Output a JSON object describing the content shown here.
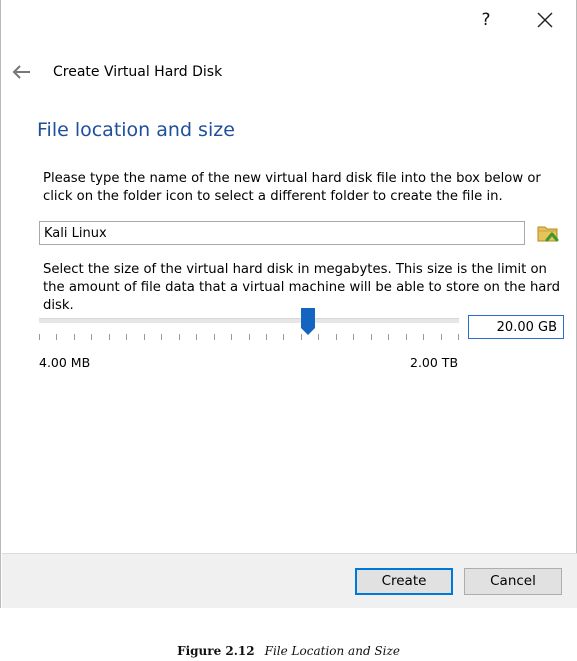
{
  "titlebar": {
    "help_label": "?"
  },
  "header": {
    "title": "Create Virtual Hard Disk"
  },
  "section": {
    "title": "File location and size"
  },
  "location": {
    "description": "Please type the name of the new virtual hard disk file into the box below or click on the folder icon to select a different folder to create the file in.",
    "value": "Kali Linux"
  },
  "size": {
    "description": "Select the size of the virtual hard disk in megabytes. This size is the limit on the amount of file data that a virtual machine will be able to store on the hard disk.",
    "value": "20.00 GB",
    "min_label": "4.00 MB",
    "max_label": "2.00 TB",
    "slider_fraction": 0.64
  },
  "buttons": {
    "create": "Create",
    "cancel": "Cancel"
  },
  "caption": {
    "label": "Figure 2.12",
    "text": "File Location and Size"
  },
  "colors": {
    "accent": "#0078d7",
    "heading": "#1e4f9c",
    "thumb": "#1565c0"
  },
  "icons": [
    "help-icon",
    "close-icon",
    "back-arrow-icon",
    "folder-icon",
    "slider-thumb"
  ]
}
